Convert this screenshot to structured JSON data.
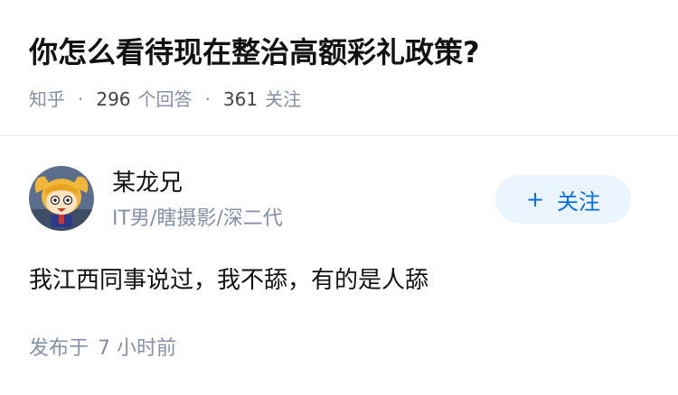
{
  "question": {
    "title": "你怎么看待现在整治高额彩礼政策?",
    "source": "知乎",
    "answer_count": "296",
    "answer_label": "个回答",
    "follower_count": "361",
    "follower_label": "关注"
  },
  "answer": {
    "author": {
      "name": "某龙兄",
      "bio": "IT男/瞎摄影/深二代",
      "avatar_icon": "cartoon-avatar-icon"
    },
    "follow_button": {
      "icon": "+",
      "label": "关注"
    },
    "content": "我江西同事说过，我不舔，有的是人舔",
    "publish_prefix": "发布于",
    "publish_time": "7 小时前"
  },
  "colors": {
    "title": "#121212",
    "meta": "#8590a6",
    "accent": "#056de8",
    "follow_bg": "#ebf5ff"
  }
}
